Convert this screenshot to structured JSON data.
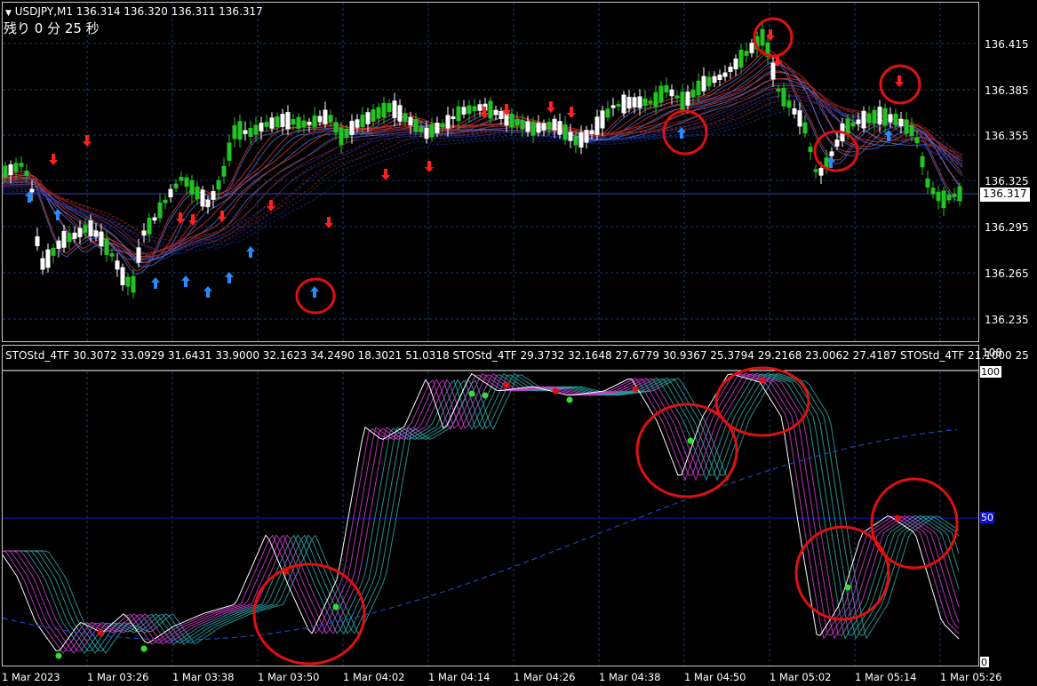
{
  "header": {
    "symbol_line": "USDJPY,M1  136.314 136.320 136.311 136.317",
    "countdown": "残り  0 分 25 秒"
  },
  "indicator_header": "STOStd_4TF 30.3072 33.0929 31.6431 33.9000 32.1623 34.2490 18.3021 51.0318   STOStd_4TF 29.3732 32.1648 27.6779 30.9367 25.3794 29.2168 23.0062 27.4187   STOStd_4TF 21.1000 25",
  "price_axis": {
    "labels": [
      "136.415",
      "136.385",
      "136.355",
      "136.325",
      "136.295",
      "136.265",
      "136.235"
    ],
    "current_price": "136.317"
  },
  "indicator_axis": {
    "labels": [
      "108",
      "100",
      "50",
      "0"
    ]
  },
  "time_axis": {
    "labels": [
      "1 Mar 2023",
      "1 Mar 03:26",
      "1 Mar 03:38",
      "1 Mar 03:50",
      "1 Mar 04:02",
      "1 Mar 04:14",
      "1 Mar 04:26",
      "1 Mar 04:38",
      "1 Mar 04:50",
      "1 Mar 05:02",
      "1 Mar 05:14",
      "1 Mar 05:26"
    ]
  },
  "colors": {
    "background": "#000000",
    "bull_candle": "#22c322",
    "bear_candle": "#ffffff",
    "grid": "#1a3a6a",
    "up_arrow": "#2a8bff",
    "down_arrow": "#ff2020",
    "circle": "#e01010",
    "stoch_magenta": "#e040e0",
    "stoch_teal": "#30b0b0",
    "level_line": "#1010d0"
  }
}
